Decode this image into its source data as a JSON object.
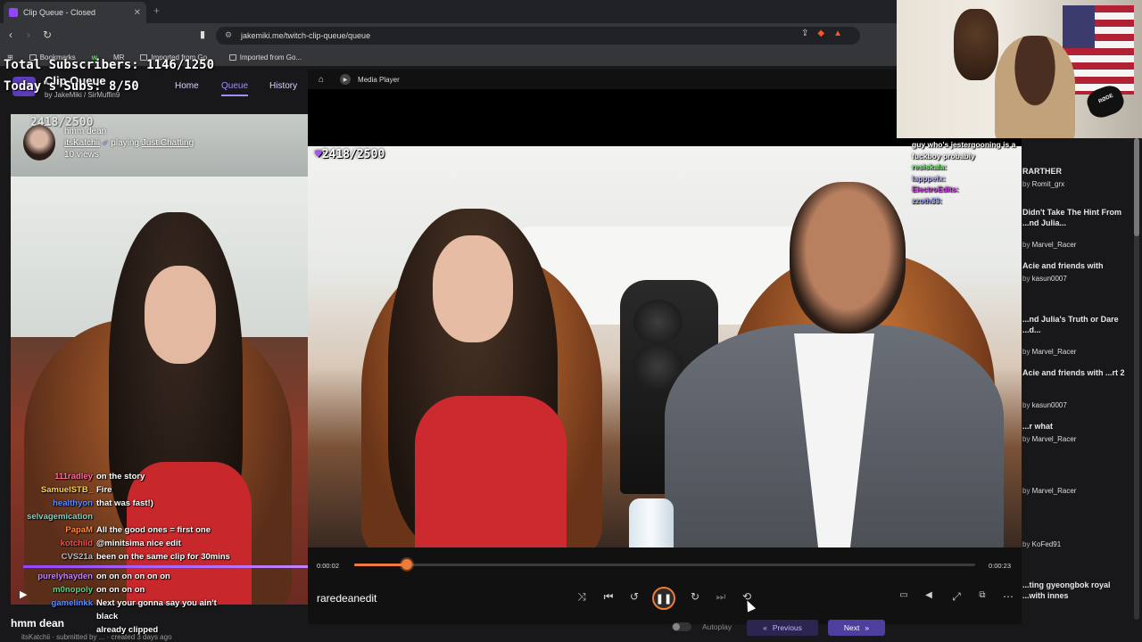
{
  "browser": {
    "tab_title": "Clip Queue - Closed",
    "url": "jakemiki.me/twitch-clip-queue/queue",
    "bookmarks": [
      "Bookmarks",
      "w",
      "MR",
      "Imported from Go...",
      "Imported from Go..."
    ]
  },
  "overlay": {
    "total_subs": "Total Subscribers: 1146/1250",
    "todays_subs": "Today's Subs: 8/50",
    "goal": "2418/2500"
  },
  "site": {
    "title": "Clip Queue",
    "by": "by JakeMiki / SirMuffin9",
    "nav": {
      "home": "Home",
      "queue": "Queue",
      "history": "History"
    }
  },
  "current_clip": {
    "title": "hmm dean",
    "channel": "itsKatchii",
    "playing_label": "playing",
    "category": "Just Chatting",
    "views": "10 views",
    "bottom_title": "hmm dean",
    "bottom_sub": "itsKatchii · submitted by ... · created 3 days ago"
  },
  "left_chat": [
    {
      "user": "111radley",
      "color": "#ff6b9a",
      "msg": "on the story"
    },
    {
      "user": "SamuelSTB_",
      "color": "#ffd34d",
      "msg": "Fire"
    },
    {
      "user": "healthyon",
      "color": "#5b8cff",
      "msg": "that was fast!)"
    },
    {
      "user": "selvagemication",
      "color": "#7fd1c6",
      "msg": ""
    },
    {
      "user": "PapaM",
      "color": "#ff8a3d",
      "msg": "All the good ones = first one"
    },
    {
      "user": "kotchild",
      "color": "#ff4d4d",
      "msg": "@minitsima nice edit"
    },
    {
      "user": "CVS21a",
      "color": "#bbbbbb",
      "msg": "been on the same clip for 30mins"
    },
    {
      "user": "purelyhayden",
      "color": "#c084fc",
      "msg": "on on on on on on"
    },
    {
      "user": "m0nopoly",
      "color": "#4ade80",
      "msg": "on on on on"
    },
    {
      "user": "gamelinkk",
      "color": "#5b8cff",
      "msg": "Next your gonna say you ain't black"
    },
    {
      "user": "",
      "color": "#ffffff",
      "msg": "already clipped"
    }
  ],
  "media_player": {
    "title": "Media Player",
    "uploader": "raredeanedit",
    "time_current": "0:00:02",
    "time_total": "0:00:23",
    "progress": 0.085
  },
  "video_chat": [
    {
      "user": "",
      "color": "#fff",
      "msg": "guy who's jestergooning is a fuckboy probably"
    },
    {
      "user": "resiskala:",
      "color": "#7cf27c",
      "msg": ""
    },
    {
      "user": "lapppefx:",
      "color": "#c4b5fd",
      "msg": ""
    },
    {
      "user": "ElectroEdits:",
      "color": "#d946ef",
      "msg": ""
    },
    {
      "user": "zzoth33:",
      "color": "#9aa0ff",
      "msg": ""
    }
  ],
  "queue_list": [
    {
      "title": "RARTHER",
      "by": "Romit_grx"
    },
    {
      "title": "Didn't Take The Hint From ...nd Julia...",
      "by": "Marvel_Racer"
    },
    {
      "title": "Acie and friends with",
      "by": "kasun0007"
    },
    {
      "title": "...nd Julia's Truth or Dare ...d...",
      "by": "Marvel_Racer"
    },
    {
      "title": "Acie and friends with ...rt 2",
      "by": "kasun0007"
    },
    {
      "title": "...r what",
      "by": "Marvel_Racer"
    },
    {
      "title": "",
      "by": "Marvel_Racer"
    },
    {
      "title": "",
      "by": "KoFed91"
    },
    {
      "title": "...ting gyeongbok royal ...with innes",
      "by": ""
    }
  ],
  "bottom": {
    "autoplay": "Autoplay",
    "previous": "Previous",
    "next": "Next"
  },
  "webcam": {
    "mic_label": "RØDE"
  },
  "colors": {
    "accent": "#f07a3a",
    "brand": "#9146ff"
  }
}
